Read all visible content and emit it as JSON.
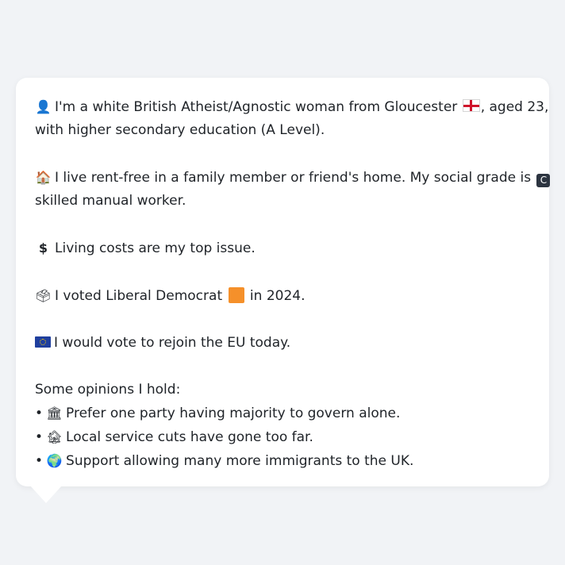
{
  "profile": {
    "identity": {
      "icon": "person-silhouette-icon",
      "line1_text": "I'm a white British Atheist/Agnostic woman from Gloucester",
      "flag": "england-flag-icon",
      "line1_end": ", aged 23,",
      "line2": "with higher secondary education (A Level)."
    },
    "housing": {
      "icon": "house-icon",
      "line1_text": "I live rent-free in a family member or friend's home. My social grade is",
      "grade_badge": "C",
      "line2": "skilled manual worker."
    },
    "issue": {
      "icon": "dollar-sign-icon",
      "text": "Living costs are my top issue."
    },
    "vote": {
      "icon": "ballot-box-icon",
      "text_before": "I voted Liberal Democrat",
      "party_color": "#f5902a",
      "text_after": "in 2024."
    },
    "eu": {
      "icon": "eu-flag-icon",
      "text": "I would vote to rejoin the EU today."
    },
    "opinions": {
      "heading": "Some opinions I hold:",
      "bullet": "•",
      "items": [
        {
          "icon": "classical-building-icon",
          "glyph": "🏛",
          "text": "Prefer one party having majority to govern alone."
        },
        {
          "icon": "derelict-house-icon",
          "glyph": "🏚",
          "text": "Local service cuts have gone too far."
        },
        {
          "icon": "globe-icon",
          "glyph": "🌍",
          "text": "Support allowing many more immigrants to the UK."
        }
      ]
    }
  },
  "colors": {
    "page_background": "#f1f3f6",
    "bubble_background": "#ffffff",
    "text": "#1f2328"
  }
}
